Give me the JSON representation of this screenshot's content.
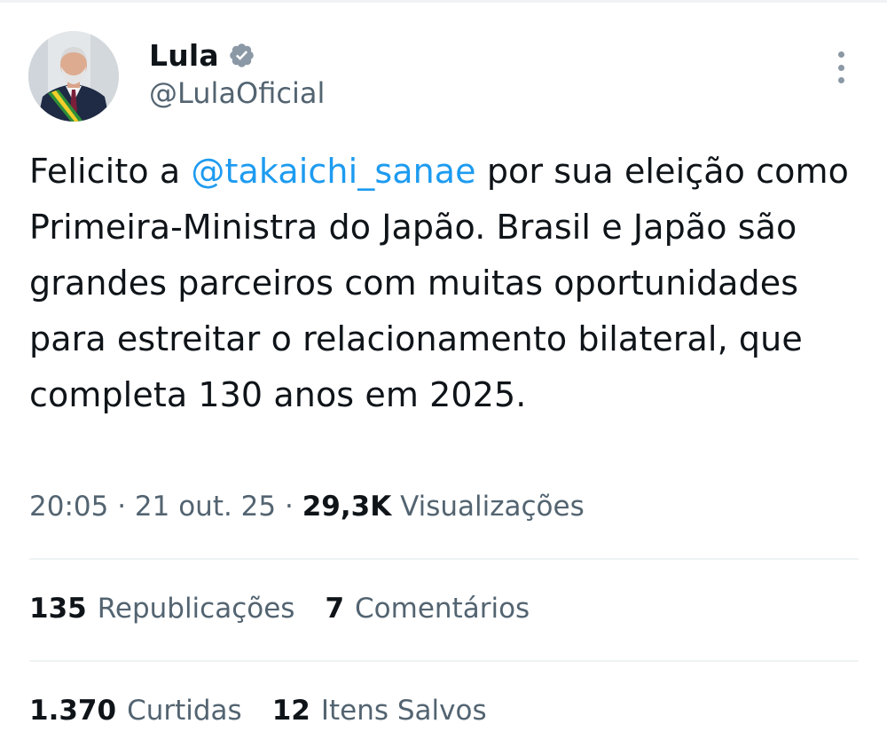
{
  "author": {
    "display_name": "Lula",
    "handle": "@LulaOficial",
    "verified": true,
    "avatar_icon": "profile-photo"
  },
  "tweet": {
    "text_before": "Felicito a ",
    "mention": "@takaichi_sanae",
    "text_after": " por sua eleição como Primeira-Ministra do Japão. Brasil e Japão são grandes parceiros com muitas oportunidades para estreitar o relacionamento bilateral, que completa 130 anos em 2025."
  },
  "meta": {
    "time": "20:05",
    "separator": " · ",
    "date": "21 out. 25",
    "views_count": "29,3K",
    "views_label": " Visualizações"
  },
  "stats": {
    "reposts_count": "135",
    "reposts_label": "Republicações",
    "comments_count": "7",
    "comments_label": "Comentários",
    "likes_count": "1.370",
    "likes_label": "Curtidas",
    "bookmarks_count": "12",
    "bookmarks_label": "Itens Salvos"
  },
  "colors": {
    "link": "#1d9bf0",
    "secondary_text": "#536471",
    "primary_text": "#0f1419",
    "divider": "#eff3f4",
    "verified_badge": "#8b98a5"
  },
  "icons": [
    "verified-badge-icon",
    "more-options-icon"
  ]
}
